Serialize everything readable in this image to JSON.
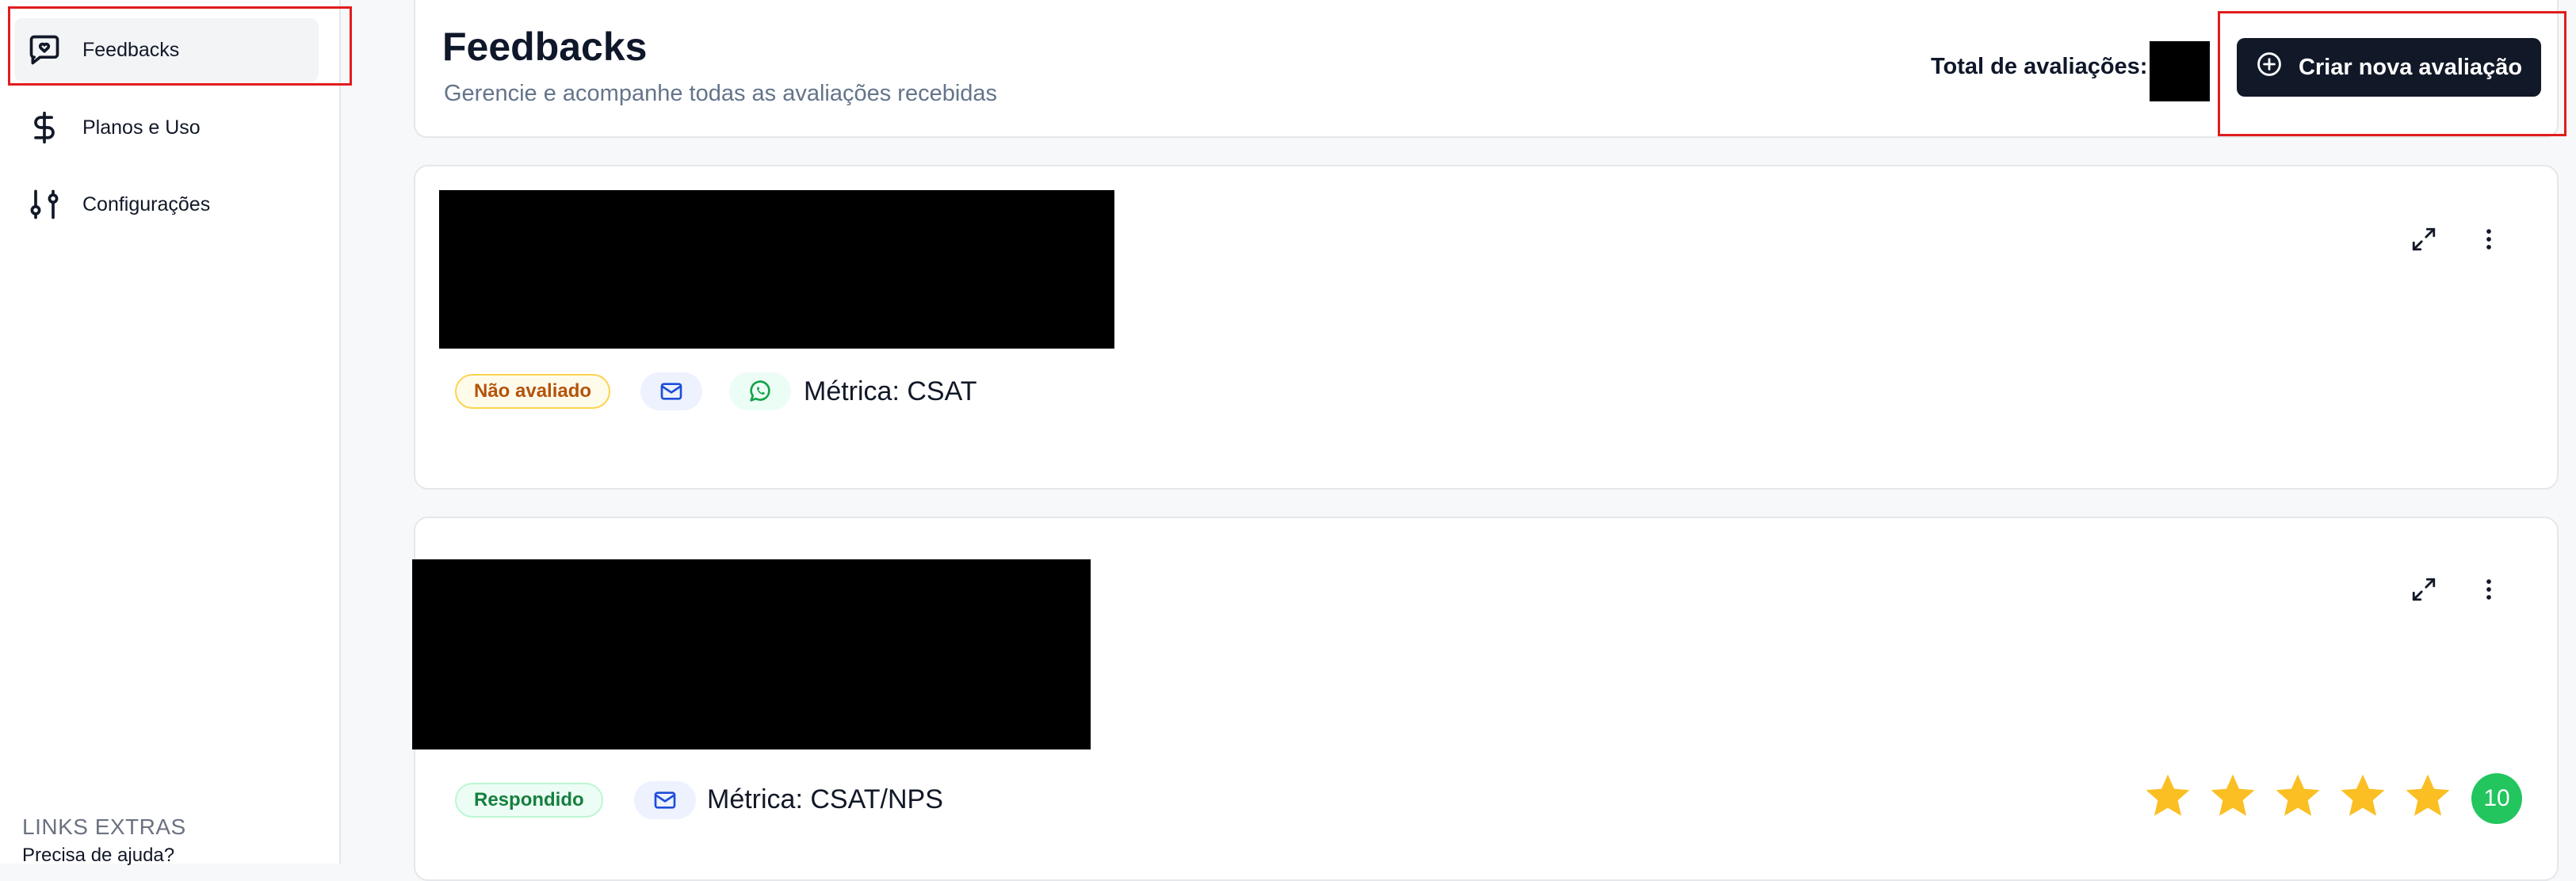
{
  "sidebar": {
    "items": [
      {
        "label": "Feedbacks",
        "icon": "message-heart-icon",
        "active": true
      },
      {
        "label": "Planos e Uso",
        "icon": "dollar-icon",
        "active": false
      },
      {
        "label": "Configurações",
        "icon": "sliders-icon",
        "active": false
      }
    ],
    "extras_title": "LINKS EXTRAS",
    "help_link": "Precisa de ajuda?"
  },
  "header": {
    "title": "Feedbacks",
    "subtitle": "Gerencie e acompanhe todas as avaliações recebidas",
    "total_label": "Total de avaliações:",
    "create_button": "Criar nova avaliação"
  },
  "cards": [
    {
      "status": "Não avaliado",
      "channels": [
        "email",
        "whatsapp"
      ],
      "metric": "Métrica: CSAT"
    },
    {
      "status": "Respondido",
      "channels": [
        "email"
      ],
      "metric": "Métrica: CSAT/NPS",
      "rating_stars": 5,
      "score": "10"
    }
  ],
  "colors": {
    "primary_button": "#111827",
    "star": "#fbbf24",
    "score_badge": "#22c55e",
    "highlight": "#e11d1d"
  }
}
